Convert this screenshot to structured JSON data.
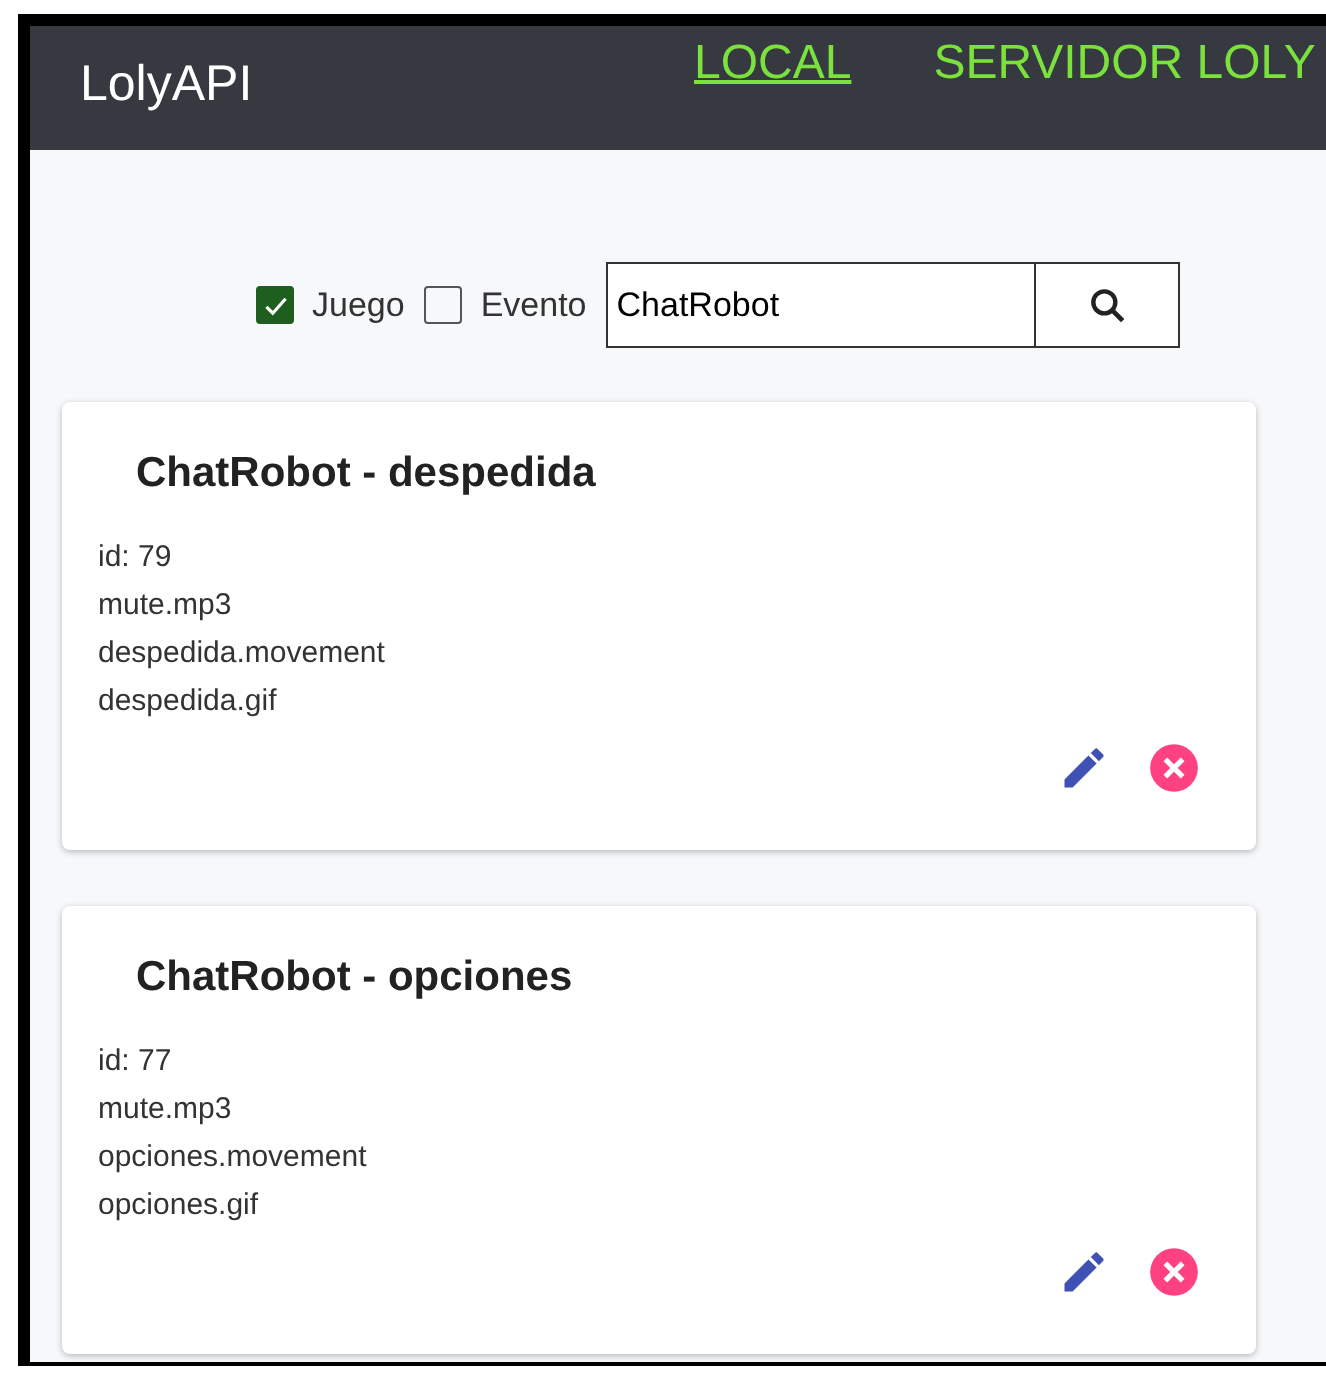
{
  "header": {
    "title": "LolyAPI",
    "links": [
      {
        "label": "LOCAL",
        "selected": true
      },
      {
        "label": "SERVIDOR LOLY",
        "selected": false
      }
    ]
  },
  "filters": [
    {
      "label": "Juego",
      "checked": true
    },
    {
      "label": "Evento",
      "checked": false
    }
  ],
  "search": {
    "value": "ChatRobot"
  },
  "cards": [
    {
      "title": "ChatRobot - despedida",
      "lines": [
        "id: 79",
        "mute.mp3",
        "despedida.movement",
        "despedida.gif"
      ]
    },
    {
      "title": "ChatRobot - opciones",
      "lines": [
        "id: 77",
        "mute.mp3",
        "opciones.movement",
        "opciones.gif"
      ]
    }
  ]
}
